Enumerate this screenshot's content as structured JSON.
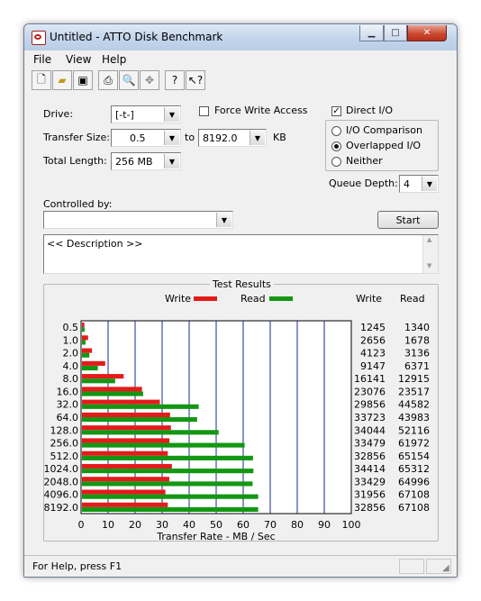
{
  "window": {
    "title": "Untitled - ATTO Disk Benchmark"
  },
  "menu": [
    "File",
    "View",
    "Help"
  ],
  "toolbar_icons": [
    "new-file-icon",
    "open-folder-icon",
    "save-icon",
    "print-icon",
    "print-preview-icon",
    "move-icon",
    "help-icon",
    "context-help-icon"
  ],
  "form": {
    "drive_label": "Drive:",
    "drive_value": "[-t-]",
    "force_write_label": "Force Write Access",
    "force_write_checked": false,
    "direct_io_label": "Direct I/O",
    "direct_io_checked": true,
    "transfer_size_label": "Transfer Size:",
    "transfer_from": "0.5",
    "to_label": "to",
    "transfer_to": "8192.0",
    "kb_label": "KB",
    "total_length_label": "Total Length:",
    "total_length_value": "256 MB",
    "io_options": [
      {
        "label": "I/O Comparison",
        "selected": false
      },
      {
        "label": "Overlapped I/O",
        "selected": true
      },
      {
        "label": "Neither",
        "selected": false
      }
    ],
    "queue_depth_label": "Queue Depth:",
    "queue_depth_value": "4",
    "controlled_by_label": "Controlled by:",
    "controlled_by_value": "",
    "start_label": "Start",
    "description": "<< Description >>"
  },
  "results": {
    "title": "Test Results",
    "legend_write": "Write",
    "legend_read": "Read",
    "col_write": "Write",
    "col_read": "Read",
    "write_color": "#e31b1b",
    "read_color": "#139713",
    "xlabel": "Transfer Rate - MB / Sec"
  },
  "chart_data": {
    "type": "bar",
    "orientation": "horizontal",
    "categories": [
      "0.5",
      "1.0",
      "2.0",
      "4.0",
      "8.0",
      "16.0",
      "32.0",
      "64.0",
      "128.0",
      "256.0",
      "512.0",
      "1024.0",
      "2048.0",
      "4096.0",
      "8192.0"
    ],
    "series": [
      {
        "name": "Write",
        "values": [
          1245,
          2656,
          4123,
          9147,
          16141,
          23076,
          29856,
          33723,
          34044,
          33479,
          32856,
          34414,
          33429,
          31956,
          32856
        ]
      },
      {
        "name": "Read",
        "values": [
          1340,
          1678,
          3136,
          6371,
          12915,
          23517,
          44582,
          43983,
          52116,
          61972,
          65154,
          65312,
          64996,
          67108,
          67108
        ]
      }
    ],
    "xlabel": "Transfer Rate - MB / Sec",
    "xlim": [
      0,
      100
    ],
    "xticks": [
      0,
      10,
      20,
      30,
      40,
      50,
      60,
      70,
      80,
      90,
      100
    ],
    "grid": true,
    "legend": "top"
  },
  "status": {
    "text": "For Help, press F1"
  }
}
